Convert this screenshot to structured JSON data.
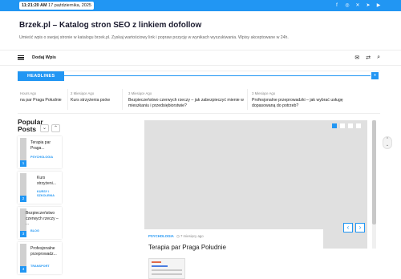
{
  "topbar": {
    "time": "11:21:20 AM",
    "date": "17 października, 2025",
    "social_icons": [
      "facebook-icon",
      "instagram-icon",
      "x-icon",
      "telegram-icon",
      "youtube-icon"
    ],
    "accent": "#2196f3"
  },
  "header": {
    "title": "Brzek.pl – Katalog stron SEO z linkiem dofollow",
    "description": "Umieść wpis o swojej stronie w katalogu brzek.pl. Zyskaj wartościowy link i popraw pozycję w wynikach wyszukiwania. Wpisy akceptowane w 24h."
  },
  "nav": {
    "link": "Dodaj Wpis",
    "icons": [
      "mail-icon",
      "shuffle-icon",
      "search-icon"
    ]
  },
  "headlines": {
    "label": "HEADLINES",
    "items": [
      {
        "time": "Hours Ago",
        "title": "na par Praga Południe"
      },
      {
        "time": "2 Miesiące Ago",
        "title": "Kurs strzyżenia psów"
      },
      {
        "time": "3 Miesiące Ago",
        "title": "Bezpieczeństwo czerwych rzeczy – jak zabezpieczyć mienie w mieszkaniu i przedsiębiorstwie?"
      },
      {
        "time": "3 Miesiące Ago",
        "title": "Profesjonalne przeprowadzki – jak wybrać usługę dopasowaną do potrzeb?"
      }
    ]
  },
  "popular": {
    "heading_line1": "Popular",
    "heading_line2": "Posts",
    "posts": [
      {
        "num": "1",
        "title": "Terapia par Praga...",
        "category": "PSYCHOLOGIA"
      },
      {
        "num": "2",
        "title": "Kurs strzyżeni...",
        "category": "KURSY I SZKOLENIA"
      },
      {
        "num": "3",
        "title": "Bezpieczeństwo czerwych rzeczy – ...",
        "category": "BLOG"
      },
      {
        "num": "4",
        "title": "Profesjonalne przeprowadz...",
        "category": "TRANSPORT"
      }
    ]
  },
  "slider": {
    "category": "PSYCHOLOGIA",
    "time": "7 miesięcy ago",
    "title": "Terapia par Praga Południe",
    "active_dot": 1,
    "dot_count": 4
  }
}
